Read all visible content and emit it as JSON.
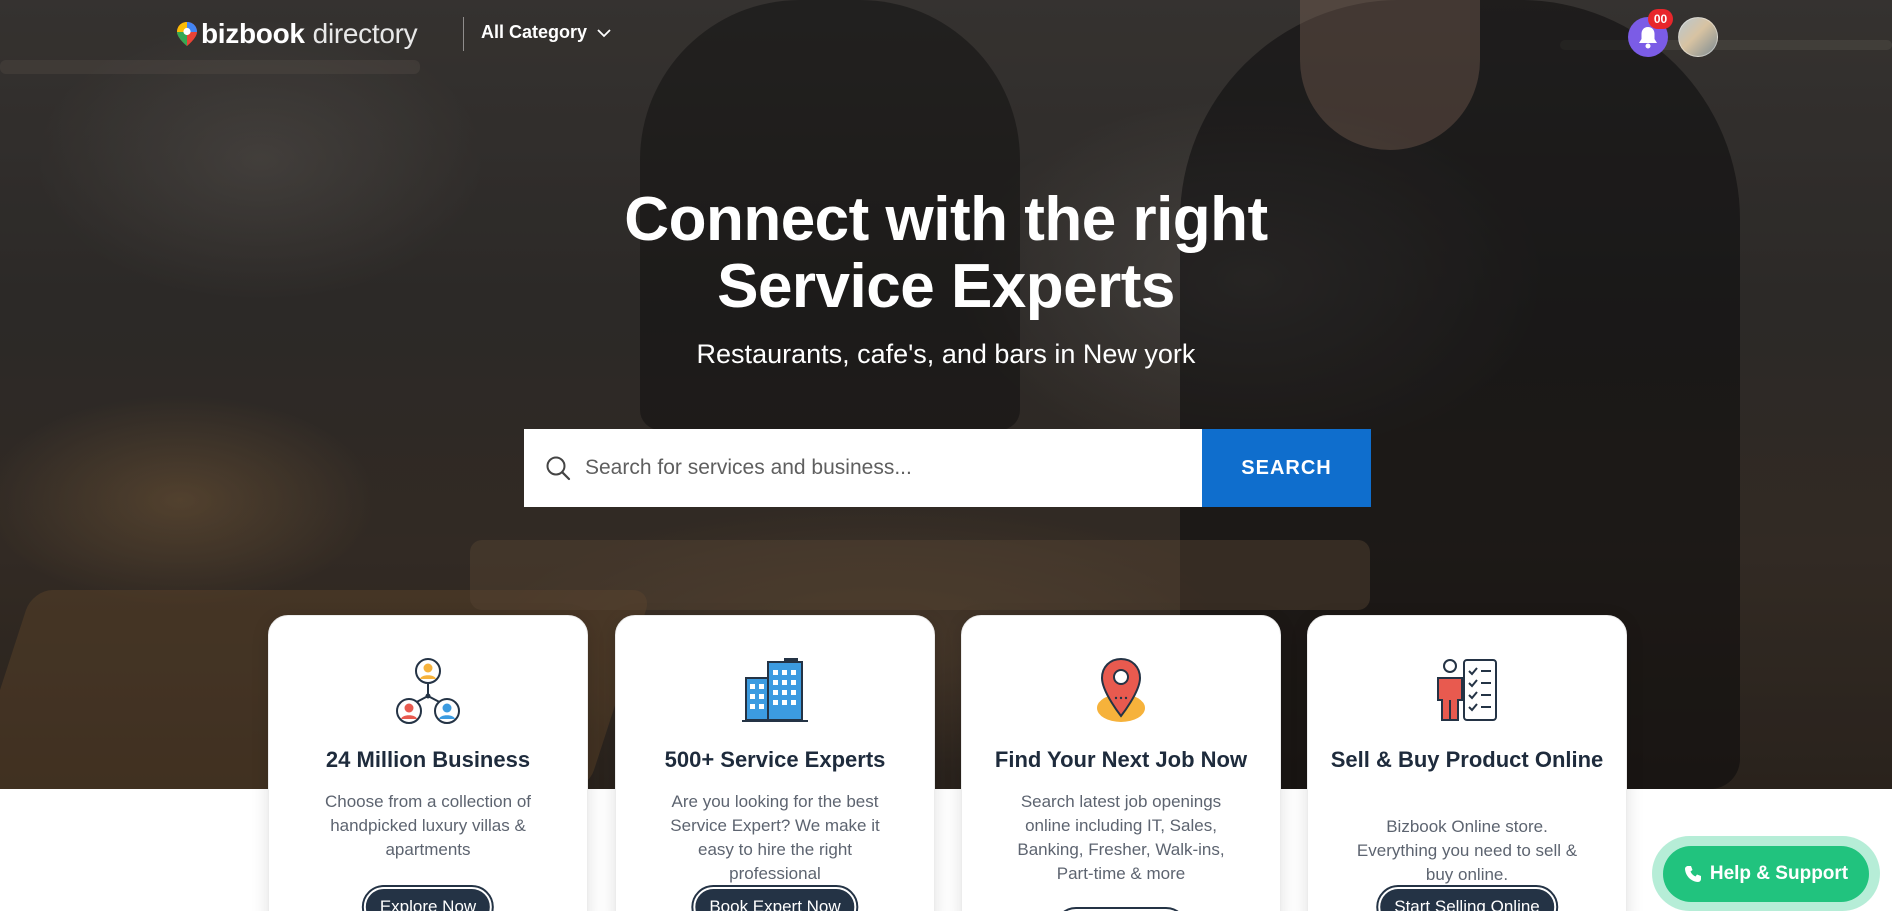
{
  "header": {
    "logo_bold": "bizbook",
    "logo_light": "directory",
    "category_label": "All Category",
    "notification_count": "00"
  },
  "hero": {
    "title_line1": "Connect with the right",
    "title_line2": "Service Experts",
    "subtitle": "Restaurants, cafe's, and bars in New york"
  },
  "search": {
    "placeholder": "Search for services and business...",
    "button_label": "SEARCH"
  },
  "cards": [
    {
      "icon": "network-people-icon",
      "title": "24 Million Business",
      "description": "Choose from a collection of handpicked luxury villas & apartments",
      "button_label": "Explore Now"
    },
    {
      "icon": "buildings-icon",
      "title": "500+ Service Experts",
      "description": "Are you looking for the best Service Expert? We make it easy to hire the right professional",
      "button_label": "Book Expert Now"
    },
    {
      "icon": "location-pin-icon",
      "title": "Find Your Next Job Now",
      "description": "Search latest job openings online including IT, Sales, Banking, Fresher, Walk-ins, Part-time & more",
      "button_label": ""
    },
    {
      "icon": "checklist-person-icon",
      "title": "Sell & Buy Product Online",
      "description": "Bizbook Online store. Everything you need to sell & buy online.",
      "button_label": "Start Selling Online"
    }
  ],
  "help": {
    "label": "Help & Support"
  },
  "colors": {
    "primary_blue": "#0f6ecd",
    "help_green": "#21c37e",
    "notification_purple": "#7b5ce6",
    "badge_red": "#e8262b",
    "dark_navy": "#243345"
  }
}
